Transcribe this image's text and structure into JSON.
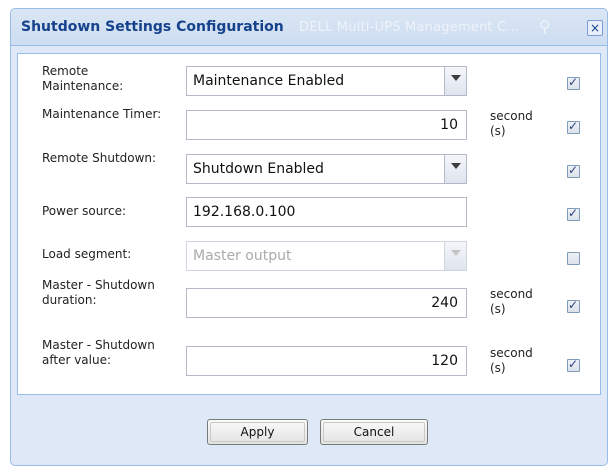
{
  "dialog": {
    "title": "Shutdown Settings Configuration",
    "background_title": "DELL Multi-UPS Management C...",
    "close_glyph": "×"
  },
  "fields": [
    {
      "label": "Remote Maintenance:",
      "type": "select",
      "value": "Maintenance Enabled",
      "unit": "",
      "checked": true
    },
    {
      "label": "Maintenance Timer:",
      "type": "number",
      "value": "10",
      "unit": "second (s)",
      "checked": true
    },
    {
      "label": "Remote Shutdown:",
      "type": "select",
      "value": "Shutdown Enabled",
      "unit": "",
      "checked": true
    },
    {
      "label": "Power source:",
      "type": "text",
      "value": "192.168.0.100",
      "unit": "",
      "checked": true
    },
    {
      "label": "Load segment:",
      "type": "select-disabled",
      "value": "Master output",
      "unit": "",
      "checked": false
    },
    {
      "label": "Master - Shutdown duration:",
      "type": "number",
      "value": "240",
      "unit": "second (s)",
      "checked": true
    },
    {
      "label": "Master - Shutdown after value:",
      "type": "number",
      "value": "120",
      "unit": "second (s)",
      "checked": true
    }
  ],
  "buttons": {
    "apply": "Apply",
    "cancel": "Cancel"
  },
  "icons": {
    "check": "✓",
    "background_search": "⚲"
  }
}
